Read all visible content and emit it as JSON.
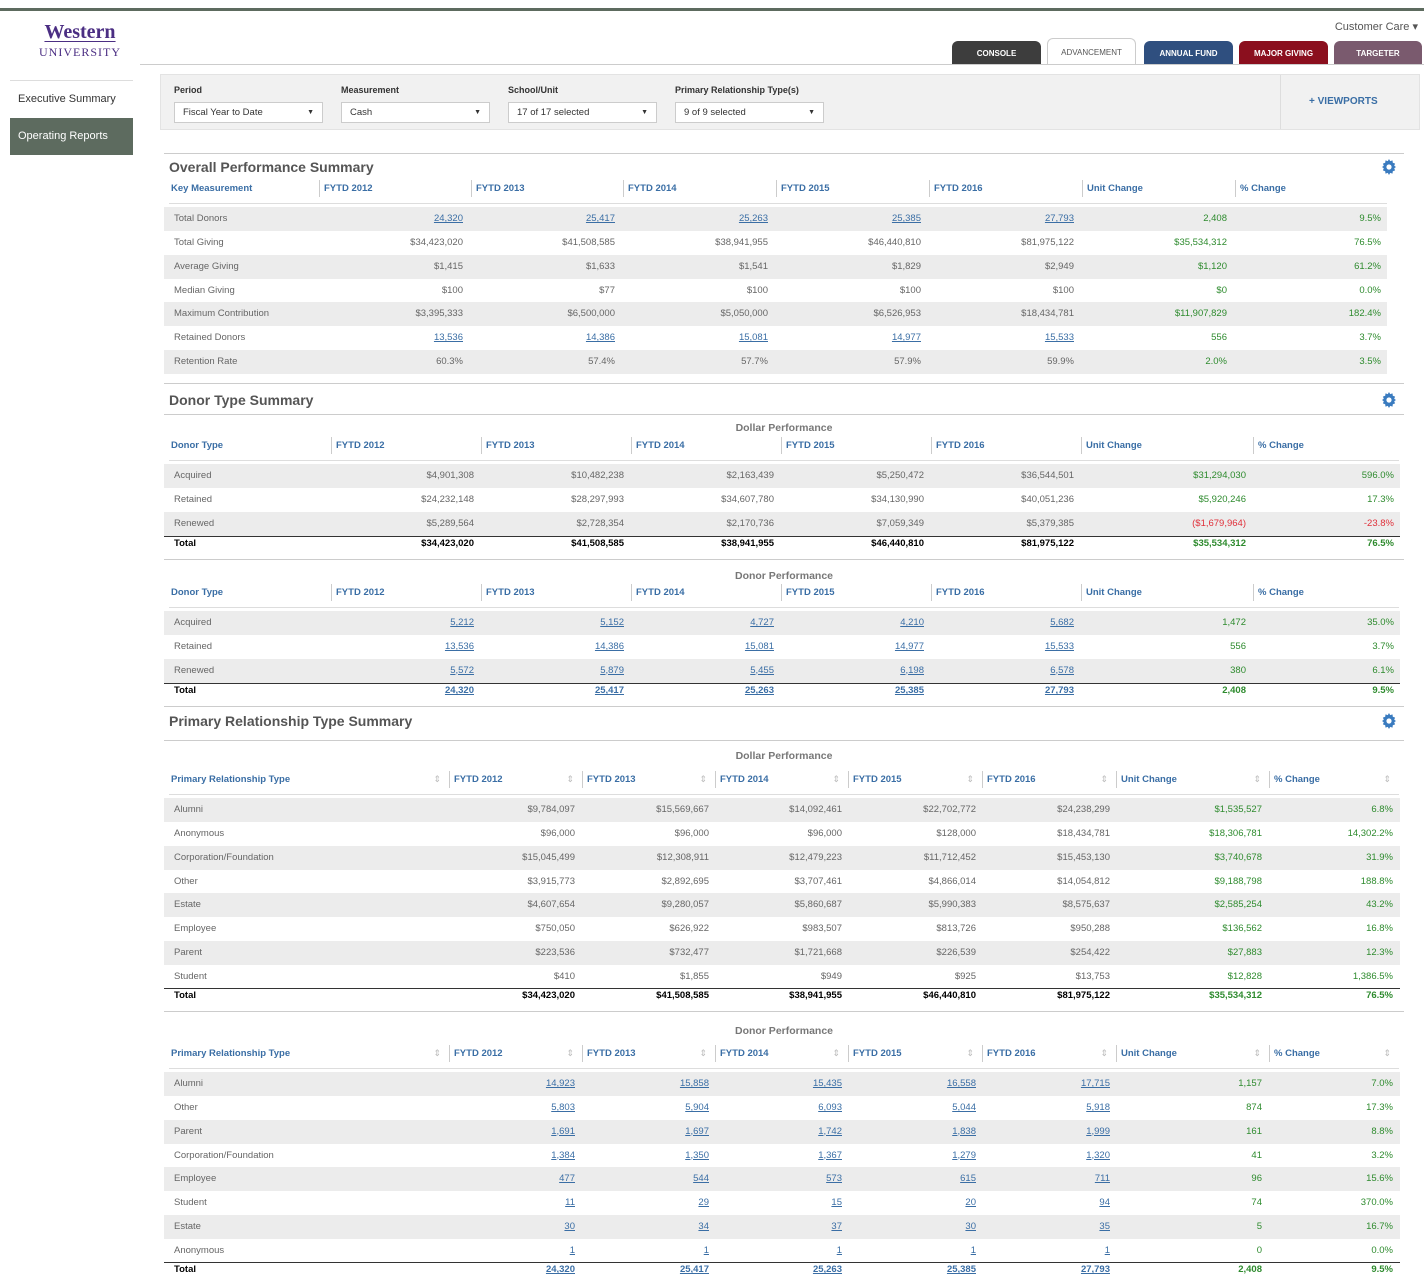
{
  "logo": {
    "line1": "Western",
    "line2": "UNIVERSITY"
  },
  "user_menu": "Customer Care ▾",
  "tabs": [
    {
      "label": "CONSOLE",
      "color": "#3d3d3d"
    },
    {
      "label": "ADVANCEMENT",
      "color": "#ffffff"
    },
    {
      "label": "ANNUAL FUND",
      "color": "#2f4f7f"
    },
    {
      "label": "MAJOR GIVING",
      "color": "#8b0f1e"
    },
    {
      "label": "TARGETER",
      "color": "#7a5a6e"
    }
  ],
  "sidebar": {
    "items": [
      {
        "label": "Executive Summary"
      },
      {
        "label": "Operating Reports"
      }
    ]
  },
  "filters": {
    "period_label": "Period",
    "period_value": "Fiscal Year to Date",
    "measurement_label": "Measurement",
    "measurement_value": "Cash",
    "school_label": "School/Unit",
    "school_value": "17 of 17 selected",
    "rel_label": "Primary Relationship Type(s)",
    "rel_value": "9 of 9 selected",
    "viewports": "+ VIEWPORTS"
  },
  "s1": {
    "title": "Overall Performance Summary",
    "headers": [
      "Key Measurement",
      "FYTD 2012",
      "FYTD 2013",
      "FYTD 2014",
      "FYTD 2015",
      "FYTD 2016",
      "Unit Change",
      "% Change"
    ],
    "rows": [
      [
        "Total Donors",
        "24,320",
        "25,417",
        "25,263",
        "25,385",
        "27,793",
        "2,408",
        "9.5%"
      ],
      [
        "Total Giving",
        "$34,423,020",
        "$41,508,585",
        "$38,941,955",
        "$46,440,810",
        "$81,975,122",
        "$35,534,312",
        "76.5%"
      ],
      [
        "Average Giving",
        "$1,415",
        "$1,633",
        "$1,541",
        "$1,829",
        "$2,949",
        "$1,120",
        "61.2%"
      ],
      [
        "Median Giving",
        "$100",
        "$77",
        "$100",
        "$100",
        "$100",
        "$0",
        "0.0%"
      ],
      [
        "Maximum Contribution",
        "$3,395,333",
        "$6,500,000",
        "$5,050,000",
        "$6,526,953",
        "$18,434,781",
        "$11,907,829",
        "182.4%"
      ],
      [
        "Retained Donors",
        "13,536",
        "14,386",
        "15,081",
        "14,977",
        "15,533",
        "556",
        "3.7%"
      ],
      [
        "Retention Rate",
        "60.3%",
        "57.4%",
        "57.7%",
        "57.9%",
        "59.9%",
        "2.0%",
        "3.5%"
      ]
    ]
  },
  "s2": {
    "title": "Donor Type Summary",
    "sub1": "Dollar Performance",
    "sub2": "Donor Performance",
    "headers": [
      "Donor Type",
      "FYTD 2012",
      "FYTD 2013",
      "FYTD 2014",
      "FYTD 2015",
      "FYTD 2016",
      "Unit Change",
      "% Change"
    ],
    "dollar_rows": [
      [
        "Acquired",
        "$4,901,308",
        "$10,482,238",
        "$2,163,439",
        "$5,250,472",
        "$36,544,501",
        "$31,294,030",
        "596.0%"
      ],
      [
        "Retained",
        "$24,232,148",
        "$28,297,993",
        "$34,607,780",
        "$34,130,990",
        "$40,051,236",
        "$5,920,246",
        "17.3%"
      ],
      [
        "Renewed",
        "$5,289,564",
        "$2,728,354",
        "$2,170,736",
        "$7,059,349",
        "$5,379,385",
        "($1,679,964)",
        "-23.8%"
      ]
    ],
    "dollar_total": [
      "Total",
      "$34,423,020",
      "$41,508,585",
      "$38,941,955",
      "$46,440,810",
      "$81,975,122",
      "$35,534,312",
      "76.5%"
    ],
    "donor_rows": [
      [
        "Acquired",
        "5,212",
        "5,152",
        "4,727",
        "4,210",
        "5,682",
        "1,472",
        "35.0%"
      ],
      [
        "Retained",
        "13,536",
        "14,386",
        "15,081",
        "14,977",
        "15,533",
        "556",
        "3.7%"
      ],
      [
        "Renewed",
        "5,572",
        "5,879",
        "5,455",
        "6,198",
        "6,578",
        "380",
        "6.1%"
      ]
    ],
    "donor_total": [
      "Total",
      "24,320",
      "25,417",
      "25,263",
      "25,385",
      "27,793",
      "2,408",
      "9.5%"
    ]
  },
  "s3": {
    "title": "Primary Relationship Type Summary",
    "sub1": "Dollar Performance",
    "sub2": "Donor Performance",
    "headers": [
      "Primary Relationship Type",
      "FYTD 2012",
      "FYTD 2013",
      "FYTD 2014",
      "FYTD 2015",
      "FYTD 2016",
      "Unit Change",
      "% Change"
    ],
    "dollar_rows": [
      [
        "Alumni",
        "$9,784,097",
        "$15,569,667",
        "$14,092,461",
        "$22,702,772",
        "$24,238,299",
        "$1,535,527",
        "6.8%"
      ],
      [
        "Anonymous",
        "$96,000",
        "$96,000",
        "$96,000",
        "$128,000",
        "$18,434,781",
        "$18,306,781",
        "14,302.2%"
      ],
      [
        "Corporation/Foundation",
        "$15,045,499",
        "$12,308,911",
        "$12,479,223",
        "$11,712,452",
        "$15,453,130",
        "$3,740,678",
        "31.9%"
      ],
      [
        "Other",
        "$3,915,773",
        "$2,892,695",
        "$3,707,461",
        "$4,866,014",
        "$14,054,812",
        "$9,188,798",
        "188.8%"
      ],
      [
        "Estate",
        "$4,607,654",
        "$9,280,057",
        "$5,860,687",
        "$5,990,383",
        "$8,575,637",
        "$2,585,254",
        "43.2%"
      ],
      [
        "Employee",
        "$750,050",
        "$626,922",
        "$983,507",
        "$813,726",
        "$950,288",
        "$136,562",
        "16.8%"
      ],
      [
        "Parent",
        "$223,536",
        "$732,477",
        "$1,721,668",
        "$226,539",
        "$254,422",
        "$27,883",
        "12.3%"
      ],
      [
        "Student",
        "$410",
        "$1,855",
        "$949",
        "$925",
        "$13,753",
        "$12,828",
        "1,386.5%"
      ]
    ],
    "dollar_total": [
      "Total",
      "$34,423,020",
      "$41,508,585",
      "$38,941,955",
      "$46,440,810",
      "$81,975,122",
      "$35,534,312",
      "76.5%"
    ],
    "donor_rows": [
      [
        "Alumni",
        "14,923",
        "15,858",
        "15,435",
        "16,558",
        "17,715",
        "1,157",
        "7.0%"
      ],
      [
        "Other",
        "5,803",
        "5,904",
        "6,093",
        "5,044",
        "5,918",
        "874",
        "17.3%"
      ],
      [
        "Parent",
        "1,691",
        "1,697",
        "1,742",
        "1,838",
        "1,999",
        "161",
        "8.8%"
      ],
      [
        "Corporation/Foundation",
        "1,384",
        "1,350",
        "1,367",
        "1,279",
        "1,320",
        "41",
        "3.2%"
      ],
      [
        "Employee",
        "477",
        "544",
        "573",
        "615",
        "711",
        "96",
        "15.6%"
      ],
      [
        "Student",
        "11",
        "29",
        "15",
        "20",
        "94",
        "74",
        "370.0%"
      ],
      [
        "Estate",
        "30",
        "34",
        "37",
        "30",
        "35",
        "5",
        "16.7%"
      ],
      [
        "Anonymous",
        "1",
        "1",
        "1",
        "1",
        "1",
        "0",
        "0.0%"
      ]
    ],
    "donor_total": [
      "Total",
      "24,320",
      "25,417",
      "25,263",
      "25,385",
      "27,793",
      "2,408",
      "9.5%"
    ]
  }
}
